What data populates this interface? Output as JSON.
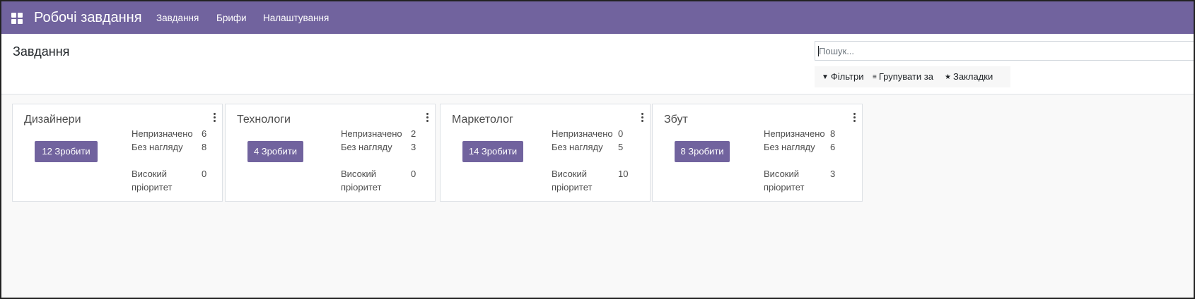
{
  "navbar": {
    "app_title": "Робочі завдання",
    "menu": [
      "Завдання",
      "Брифи",
      "Налаштування"
    ]
  },
  "control_panel": {
    "title": "Завдання",
    "search_placeholder": "Пошук...",
    "options": {
      "filters": "Фільтри",
      "group_by": "Групувати за",
      "favorites": "Закладки"
    }
  },
  "cards": [
    {
      "title": "Дизайнери",
      "todo": "12 Зробити",
      "stats": [
        {
          "label": "Непризначено",
          "count": "6"
        },
        {
          "label": "Без нагляду",
          "count": "8"
        },
        {
          "label": "Високий пріоритет",
          "count": "0"
        }
      ]
    },
    {
      "title": "Технологи",
      "todo": "4 Зробити",
      "stats": [
        {
          "label": "Непризначено",
          "count": "2"
        },
        {
          "label": "Без нагляду",
          "count": "3"
        },
        {
          "label": "Високий пріоритет",
          "count": "0"
        }
      ]
    },
    {
      "title": "Маркетолог",
      "todo": "14 Зробити",
      "stats": [
        {
          "label": "Непризначено",
          "count": "0"
        },
        {
          "label": "Без нагляду",
          "count": "5"
        },
        {
          "label": "Високий пріоритет",
          "count": "10"
        }
      ]
    },
    {
      "title": "Збут",
      "todo": "8 Зробити",
      "stats": [
        {
          "label": "Непризначено",
          "count": "8"
        },
        {
          "label": "Без нагляду",
          "count": "6"
        },
        {
          "label": "Високий пріоритет",
          "count": "3"
        }
      ]
    }
  ],
  "colors": {
    "brand": "#71639e",
    "background": "#f9f9f9"
  },
  "icons": {
    "apps": "apps-grid-icon",
    "filter": "filter-icon",
    "group_by": "list-icon",
    "favorites": "star-icon",
    "card_menu": "kebab-menu-icon"
  }
}
